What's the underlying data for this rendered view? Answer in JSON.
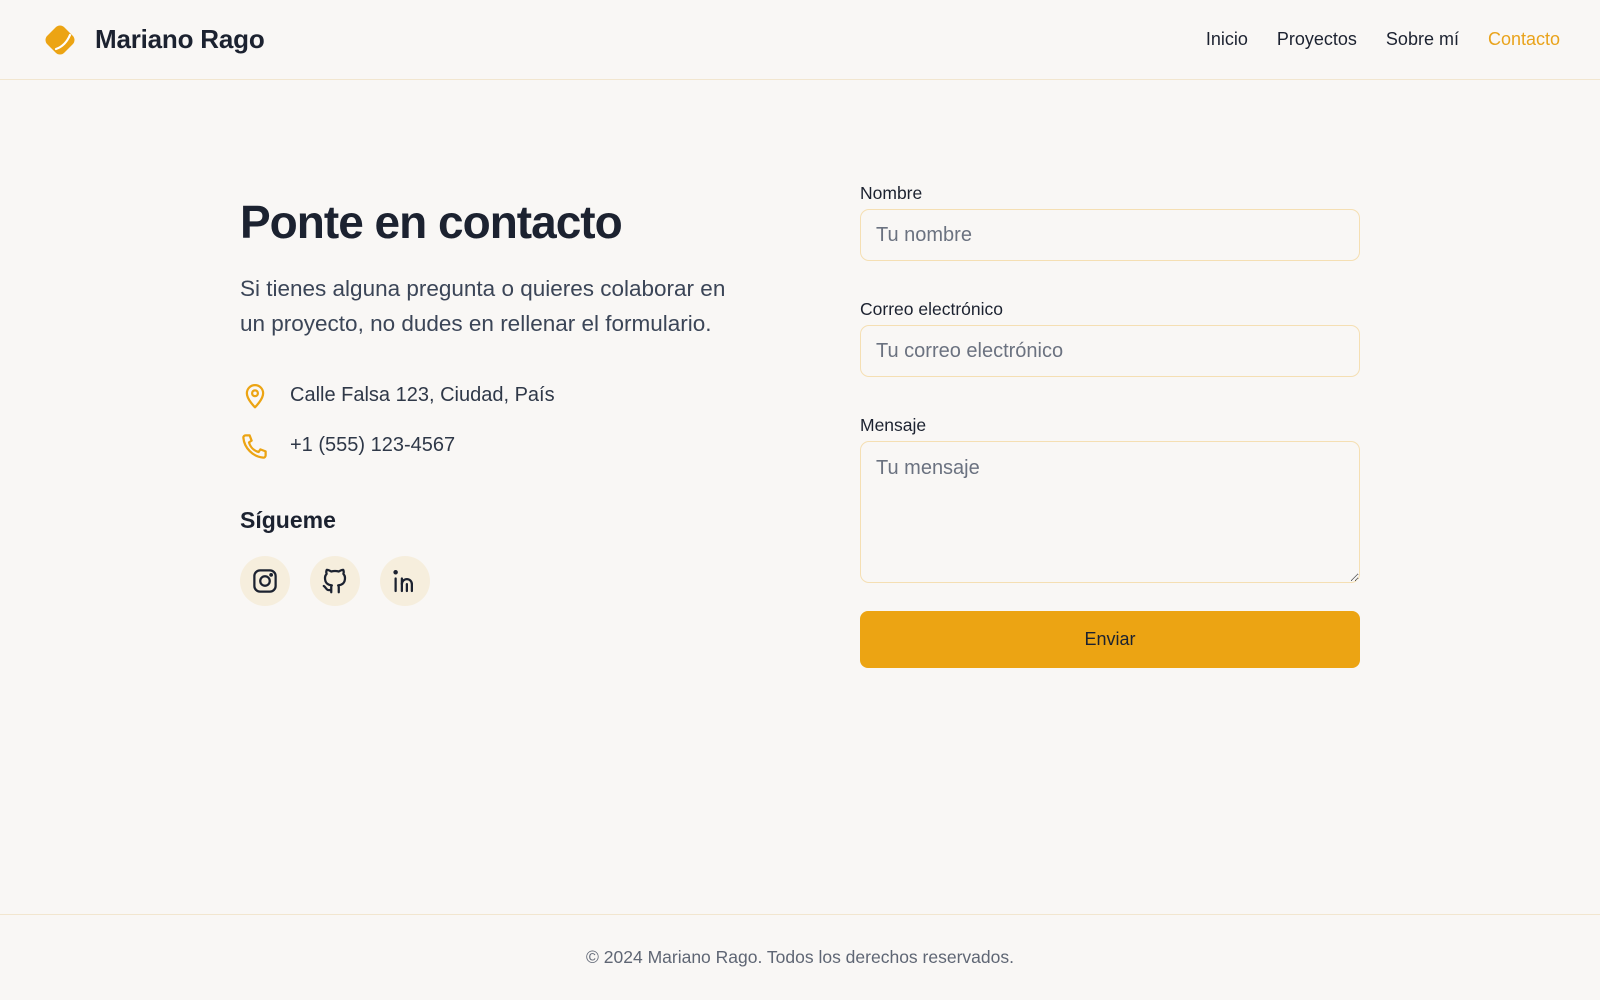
{
  "header": {
    "brand_name": "Mariano Rago",
    "logo_icon": "tag-logo-icon",
    "nav": [
      {
        "label": "Inicio",
        "active": false
      },
      {
        "label": "Proyectos",
        "active": false
      },
      {
        "label": "Sobre mí",
        "active": false
      },
      {
        "label": "Contacto",
        "active": true
      }
    ]
  },
  "contact": {
    "title": "Ponte en contacto",
    "intro": "Si tienes alguna pregunta o quieres colaborar en un proyecto, no dudes en rellenar el formulario.",
    "address": {
      "icon": "map-pin-icon",
      "text": "Calle Falsa 123, Ciudad, País"
    },
    "phone": {
      "icon": "phone-icon",
      "text": "+1 (555) 123-4567"
    },
    "follow_title": "Sígueme",
    "socials": [
      {
        "icon": "instagram-icon"
      },
      {
        "icon": "github-icon"
      },
      {
        "icon": "linkedin-icon"
      }
    ]
  },
  "form": {
    "name": {
      "label": "Nombre",
      "placeholder": "Tu nombre",
      "value": ""
    },
    "email": {
      "label": "Correo electrónico",
      "placeholder": "Tu correo electrónico",
      "value": ""
    },
    "message": {
      "label": "Mensaje",
      "placeholder": "Tu mensaje",
      "value": ""
    },
    "submit_label": "Enviar"
  },
  "footer": {
    "text": "© 2024 Mariano Rago. Todos los derechos reservados."
  },
  "colors": {
    "accent": "#eca413",
    "background": "#f9f7f5",
    "text": "#1c2230",
    "border": "#f5dfb3"
  }
}
